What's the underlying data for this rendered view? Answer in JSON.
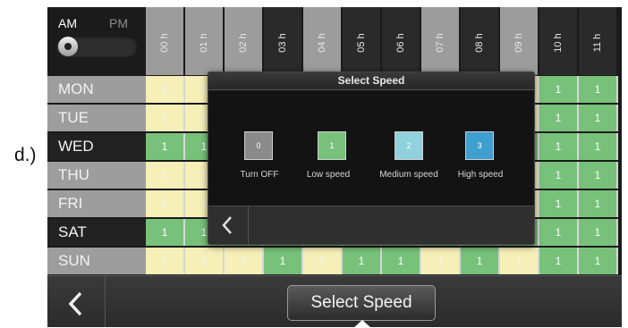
{
  "caption": "d.)",
  "ampm": {
    "am": "AM",
    "pm": "PM",
    "selected": "AM"
  },
  "hours": [
    {
      "label": "00 h",
      "shade": "light"
    },
    {
      "label": "01 h",
      "shade": "light"
    },
    {
      "label": "02 h",
      "shade": "light"
    },
    {
      "label": "03 h",
      "shade": "dark"
    },
    {
      "label": "04 h",
      "shade": "light"
    },
    {
      "label": "05 h",
      "shade": "dark"
    },
    {
      "label": "06 h",
      "shade": "dark"
    },
    {
      "label": "07 h",
      "shade": "light"
    },
    {
      "label": "08 h",
      "shade": "dark"
    },
    {
      "label": "09 h",
      "shade": "light"
    },
    {
      "label": "10 h",
      "shade": "dark"
    },
    {
      "label": "11 h",
      "shade": "dark"
    }
  ],
  "schedule": [
    {
      "day": "MON",
      "shade": "light",
      "cells": [
        "y",
        "y",
        "y",
        "y",
        "y",
        "y",
        "y",
        "y",
        "y",
        "y",
        "g",
        "g"
      ]
    },
    {
      "day": "TUE",
      "shade": "light",
      "cells": [
        "y",
        "y",
        "y",
        "y",
        "y",
        "y",
        "y",
        "y",
        "y",
        "y",
        "g",
        "g"
      ]
    },
    {
      "day": "WED",
      "shade": "dark",
      "cells": [
        "g",
        "g",
        "g",
        "g",
        "g",
        "g",
        "g",
        "g",
        "g",
        "g",
        "g",
        "g"
      ]
    },
    {
      "day": "THU",
      "shade": "light",
      "cells": [
        "y",
        "y",
        "y",
        "y",
        "y",
        "y",
        "y",
        "y",
        "y",
        "y",
        "g",
        "g"
      ]
    },
    {
      "day": "FRI",
      "shade": "light",
      "cells": [
        "y",
        "y",
        "y",
        "y",
        "y",
        "y",
        "y",
        "y",
        "y",
        "y",
        "g",
        "g"
      ]
    },
    {
      "day": "SAT",
      "shade": "dark",
      "cells": [
        "g",
        "g",
        "g",
        "g",
        "g",
        "g",
        "g",
        "g",
        "g",
        "g",
        "g",
        "g"
      ]
    },
    {
      "day": "SUN",
      "shade": "light",
      "cells": [
        "y",
        "y",
        "y",
        "g",
        "y",
        "g",
        "g",
        "y",
        "g",
        "y",
        "g",
        "g"
      ]
    }
  ],
  "cell_value": "1",
  "colors": {
    "low": "#78c17a",
    "off_cell": "#f6efb7",
    "medium": "#8fd2dd",
    "high": "#3f9fcf",
    "turn_off": "#8a8a8a"
  },
  "dialog": {
    "title": "Select Speed",
    "options": [
      {
        "value": "0",
        "label": "Turn OFF",
        "color": "#8a8a8a"
      },
      {
        "value": "1",
        "label": "Low speed",
        "color": "#78c17a"
      },
      {
        "value": "2",
        "label": "Medium speed",
        "color": "#8fd2dd"
      },
      {
        "value": "3",
        "label": "High speed",
        "color": "#3f9fcf"
      }
    ],
    "back_icon": "chevron-left-icon"
  },
  "bottom_bar": {
    "back_icon": "chevron-left-icon",
    "select_button": "Select Speed"
  }
}
